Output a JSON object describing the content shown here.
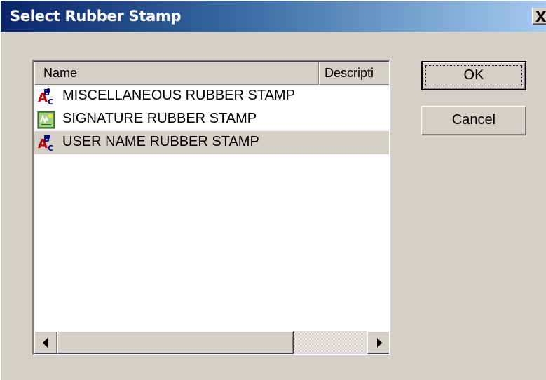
{
  "window": {
    "title": "Select Rubber Stamp",
    "close_label": "X"
  },
  "list": {
    "columns": [
      "Name",
      "Descripti"
    ],
    "rows": [
      {
        "name": "MISCELLANEOUS RUBBER STAMP",
        "icon": "abc-stamp-icon",
        "selected": false
      },
      {
        "name": "SIGNATURE RUBBER STAMP",
        "icon": "signature-stamp-icon",
        "selected": false
      },
      {
        "name": "USER NAME RUBBER STAMP",
        "icon": "abc-stamp-icon",
        "selected": true
      }
    ]
  },
  "buttons": {
    "ok": "OK",
    "cancel": "Cancel"
  },
  "colors": {
    "title_gradient_start": "#0a246a",
    "title_gradient_end": "#a6caf0",
    "face": "#d4d0c8",
    "selection": "#d4d0c8"
  }
}
